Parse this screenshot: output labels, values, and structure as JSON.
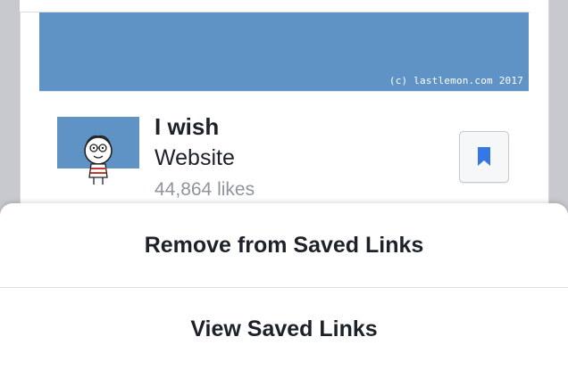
{
  "post": {
    "banner_credit": "(c) lastlemon.com 2017",
    "page": {
      "title": "I wish",
      "category": "Website",
      "likes": "44,864 likes"
    }
  },
  "action_sheet": {
    "items": [
      {
        "label": "Remove from Saved Links"
      },
      {
        "label": "View Saved Links"
      }
    ]
  },
  "icons": {
    "save": "bookmark-icon"
  },
  "colors": {
    "banner": "#5f93c6",
    "bookmark": "#3578e5",
    "text": "#1d2129",
    "muted": "#90949c"
  }
}
